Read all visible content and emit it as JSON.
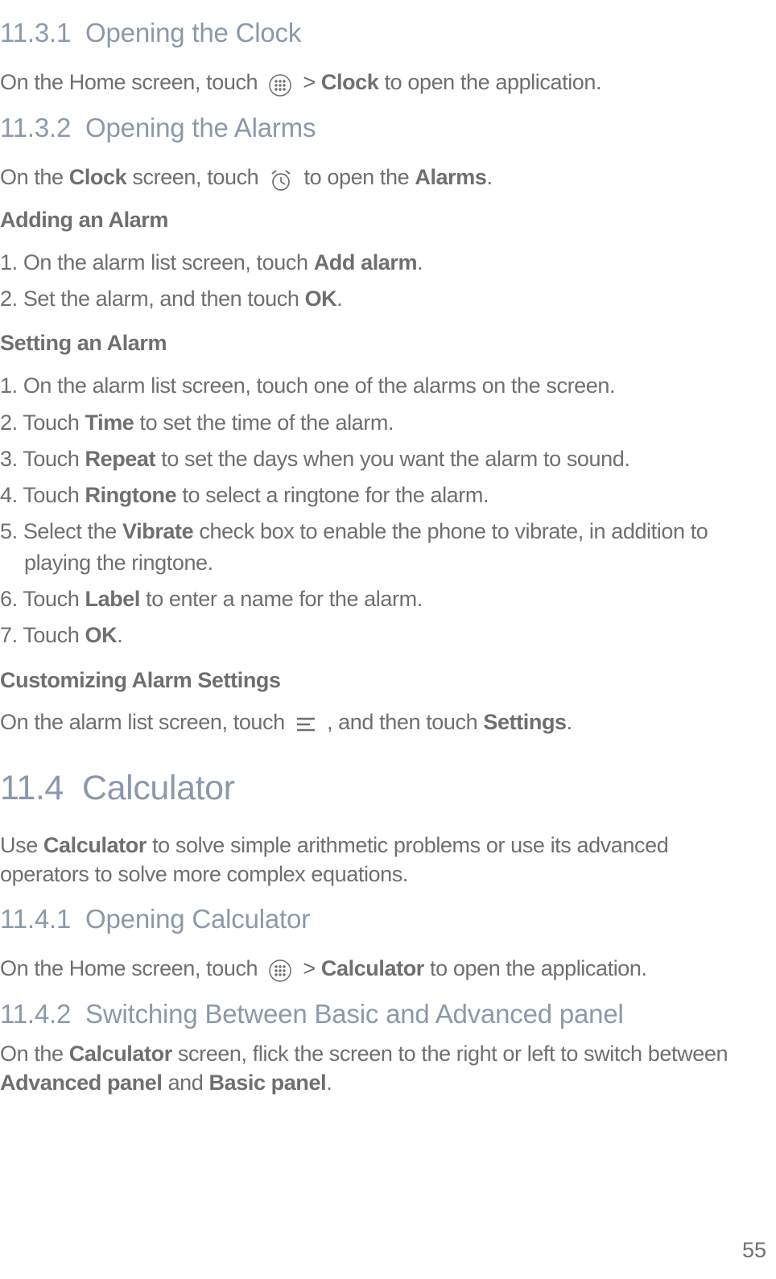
{
  "sections": {
    "s1": {
      "heading_num": "11.3.1",
      "heading_text": "Opening the Clock",
      "p1_pre": "On the Home screen, touch ",
      "p1_mid": " > ",
      "p1_bold": "Clock",
      "p1_post": " to open the application."
    },
    "s2": {
      "heading_num": "11.3.2",
      "heading_text": "Opening the Alarms",
      "p1_pre": "On the ",
      "p1_b1": "Clock",
      "p1_mid1": " screen, touch ",
      "p1_mid2": " to open the ",
      "p1_b2": "Alarms",
      "p1_post": "."
    },
    "addAlarm": {
      "title": "Adding an Alarm",
      "items": {
        "i1_pre": "1. On the alarm list screen, touch ",
        "i1_b": "Add alarm",
        "i1_post": ".",
        "i2_pre": "2. Set the alarm, and then touch ",
        "i2_b": "OK",
        "i2_post": "."
      }
    },
    "setAlarm": {
      "title": "Setting an Alarm",
      "items": {
        "i1": "1. On the alarm list screen, touch one of the alarms on the screen.",
        "i2_pre": "2. Touch ",
        "i2_b": "Time",
        "i2_post": " to set the time of the alarm.",
        "i3_pre": "3. Touch ",
        "i3_b": "Repeat",
        "i3_post": " to set the days when you want the alarm to sound.",
        "i4_pre": "4. Touch ",
        "i4_b": "Ringtone",
        "i4_post": " to select a ringtone for the alarm.",
        "i5_pre": "5. Select the ",
        "i5_b": "Vibrate",
        "i5_post": " check box to enable the phone to vibrate, in addition to playing the ringtone.",
        "i6_pre": "6. Touch ",
        "i6_b": "Label",
        "i6_post": " to enter a name for the alarm.",
        "i7_pre": "7. Touch ",
        "i7_b": "OK",
        "i7_post": "."
      }
    },
    "customAlarm": {
      "title": "Customizing Alarm Settings",
      "p_pre": "On the alarm list screen, touch ",
      "p_mid": " , and then touch ",
      "p_b": "Settings",
      "p_post": "."
    },
    "calc": {
      "heading_num": "11.4",
      "heading_text": "Calculator",
      "p_pre": "Use ",
      "p_b": "Calculator",
      "p_post": " to solve simple arithmetic problems or use its advanced operators to solve more complex equations."
    },
    "calc1": {
      "heading_num": "11.4.1",
      "heading_text": "Opening Calculator",
      "p_pre": "On the Home screen, touch ",
      "p_mid": " > ",
      "p_b": "Calculator",
      "p_post": " to open the application."
    },
    "calc2": {
      "heading_num": "11.4.2",
      "heading_text": "Switching Between Basic and Advanced panel",
      "p_pre": "On the ",
      "p_b1": "Calculator",
      "p_mid1": " screen, flick the screen to the right or left to switch between ",
      "p_b2": "Advanced panel",
      "p_mid2": " and ",
      "p_b3": "Basic panel",
      "p_post": "."
    }
  },
  "pageNumber": "55"
}
